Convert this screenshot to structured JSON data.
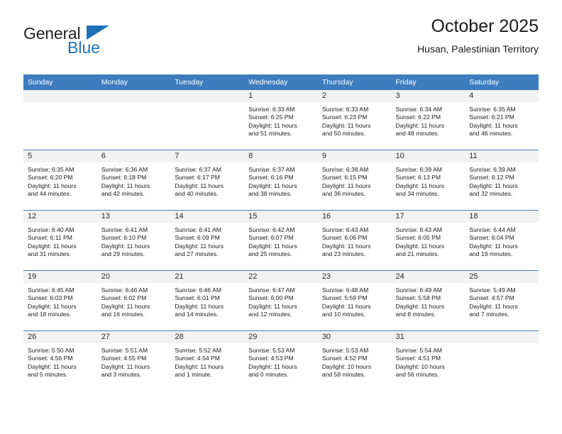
{
  "brand": {
    "name_top": "General",
    "name_bottom": "Blue",
    "triangle_color": "#1c72b8"
  },
  "header": {
    "title": "October 2025",
    "subtitle": "Husan, Palestinian Territory"
  },
  "colors": {
    "header_row_background": "#3d7dbf",
    "header_row_text": "#ffffff",
    "daynumber_background": "#f2f2f2",
    "row_divider": "#4a7fb5",
    "brand_blue": "#1c72b8"
  },
  "weekday_headers": [
    "Sunday",
    "Monday",
    "Tuesday",
    "Wednesday",
    "Thursday",
    "Friday",
    "Saturday"
  ],
  "weeks": [
    [
      {
        "day": "",
        "lines": []
      },
      {
        "day": "",
        "lines": []
      },
      {
        "day": "",
        "lines": []
      },
      {
        "day": "1",
        "lines": [
          "Sunrise: 6:33 AM",
          "Sunset: 6:25 PM",
          "Daylight: 11 hours",
          "and 51 minutes."
        ]
      },
      {
        "day": "2",
        "lines": [
          "Sunrise: 6:33 AM",
          "Sunset: 6:23 PM",
          "Daylight: 11 hours",
          "and 50 minutes."
        ]
      },
      {
        "day": "3",
        "lines": [
          "Sunrise: 6:34 AM",
          "Sunset: 6:22 PM",
          "Daylight: 11 hours",
          "and 48 minutes."
        ]
      },
      {
        "day": "4",
        "lines": [
          "Sunrise: 6:35 AM",
          "Sunset: 6:21 PM",
          "Daylight: 11 hours",
          "and 46 minutes."
        ]
      }
    ],
    [
      {
        "day": "5",
        "lines": [
          "Sunrise: 6:35 AM",
          "Sunset: 6:20 PM",
          "Daylight: 11 hours",
          "and 44 minutes."
        ]
      },
      {
        "day": "6",
        "lines": [
          "Sunrise: 6:36 AM",
          "Sunset: 6:18 PM",
          "Daylight: 11 hours",
          "and 42 minutes."
        ]
      },
      {
        "day": "7",
        "lines": [
          "Sunrise: 6:37 AM",
          "Sunset: 6:17 PM",
          "Daylight: 11 hours",
          "and 40 minutes."
        ]
      },
      {
        "day": "8",
        "lines": [
          "Sunrise: 6:37 AM",
          "Sunset: 6:16 PM",
          "Daylight: 11 hours",
          "and 38 minutes."
        ]
      },
      {
        "day": "9",
        "lines": [
          "Sunrise: 6:38 AM",
          "Sunset: 6:15 PM",
          "Daylight: 11 hours",
          "and 36 minutes."
        ]
      },
      {
        "day": "10",
        "lines": [
          "Sunrise: 6:39 AM",
          "Sunset: 6:13 PM",
          "Daylight: 11 hours",
          "and 34 minutes."
        ]
      },
      {
        "day": "11",
        "lines": [
          "Sunrise: 6:39 AM",
          "Sunset: 6:12 PM",
          "Daylight: 11 hours",
          "and 32 minutes."
        ]
      }
    ],
    [
      {
        "day": "12",
        "lines": [
          "Sunrise: 6:40 AM",
          "Sunset: 6:11 PM",
          "Daylight: 11 hours",
          "and 31 minutes."
        ]
      },
      {
        "day": "13",
        "lines": [
          "Sunrise: 6:41 AM",
          "Sunset: 6:10 PM",
          "Daylight: 11 hours",
          "and 29 minutes."
        ]
      },
      {
        "day": "14",
        "lines": [
          "Sunrise: 6:41 AM",
          "Sunset: 6:09 PM",
          "Daylight: 11 hours",
          "and 27 minutes."
        ]
      },
      {
        "day": "15",
        "lines": [
          "Sunrise: 6:42 AM",
          "Sunset: 6:07 PM",
          "Daylight: 11 hours",
          "and 25 minutes."
        ]
      },
      {
        "day": "16",
        "lines": [
          "Sunrise: 6:43 AM",
          "Sunset: 6:06 PM",
          "Daylight: 11 hours",
          "and 23 minutes."
        ]
      },
      {
        "day": "17",
        "lines": [
          "Sunrise: 6:43 AM",
          "Sunset: 6:05 PM",
          "Daylight: 11 hours",
          "and 21 minutes."
        ]
      },
      {
        "day": "18",
        "lines": [
          "Sunrise: 6:44 AM",
          "Sunset: 6:04 PM",
          "Daylight: 11 hours",
          "and 19 minutes."
        ]
      }
    ],
    [
      {
        "day": "19",
        "lines": [
          "Sunrise: 6:45 AM",
          "Sunset: 6:03 PM",
          "Daylight: 11 hours",
          "and 18 minutes."
        ]
      },
      {
        "day": "20",
        "lines": [
          "Sunrise: 6:46 AM",
          "Sunset: 6:02 PM",
          "Daylight: 11 hours",
          "and 16 minutes."
        ]
      },
      {
        "day": "21",
        "lines": [
          "Sunrise: 6:46 AM",
          "Sunset: 6:01 PM",
          "Daylight: 11 hours",
          "and 14 minutes."
        ]
      },
      {
        "day": "22",
        "lines": [
          "Sunrise: 6:47 AM",
          "Sunset: 6:00 PM",
          "Daylight: 11 hours",
          "and 12 minutes."
        ]
      },
      {
        "day": "23",
        "lines": [
          "Sunrise: 6:48 AM",
          "Sunset: 5:59 PM",
          "Daylight: 11 hours",
          "and 10 minutes."
        ]
      },
      {
        "day": "24",
        "lines": [
          "Sunrise: 6:49 AM",
          "Sunset: 5:58 PM",
          "Daylight: 11 hours",
          "and 8 minutes."
        ]
      },
      {
        "day": "25",
        "lines": [
          "Sunrise: 5:49 AM",
          "Sunset: 4:57 PM",
          "Daylight: 11 hours",
          "and 7 minutes."
        ]
      }
    ],
    [
      {
        "day": "26",
        "lines": [
          "Sunrise: 5:50 AM",
          "Sunset: 4:56 PM",
          "Daylight: 11 hours",
          "and 5 minutes."
        ]
      },
      {
        "day": "27",
        "lines": [
          "Sunrise: 5:51 AM",
          "Sunset: 4:55 PM",
          "Daylight: 11 hours",
          "and 3 minutes."
        ]
      },
      {
        "day": "28",
        "lines": [
          "Sunrise: 5:52 AM",
          "Sunset: 4:54 PM",
          "Daylight: 11 hours",
          "and 1 minute."
        ]
      },
      {
        "day": "29",
        "lines": [
          "Sunrise: 5:53 AM",
          "Sunset: 4:53 PM",
          "Daylight: 11 hours",
          "and 0 minutes."
        ]
      },
      {
        "day": "30",
        "lines": [
          "Sunrise: 5:53 AM",
          "Sunset: 4:52 PM",
          "Daylight: 10 hours",
          "and 58 minutes."
        ]
      },
      {
        "day": "31",
        "lines": [
          "Sunrise: 5:54 AM",
          "Sunset: 4:51 PM",
          "Daylight: 10 hours",
          "and 56 minutes."
        ]
      },
      {
        "day": "",
        "lines": []
      }
    ]
  ]
}
